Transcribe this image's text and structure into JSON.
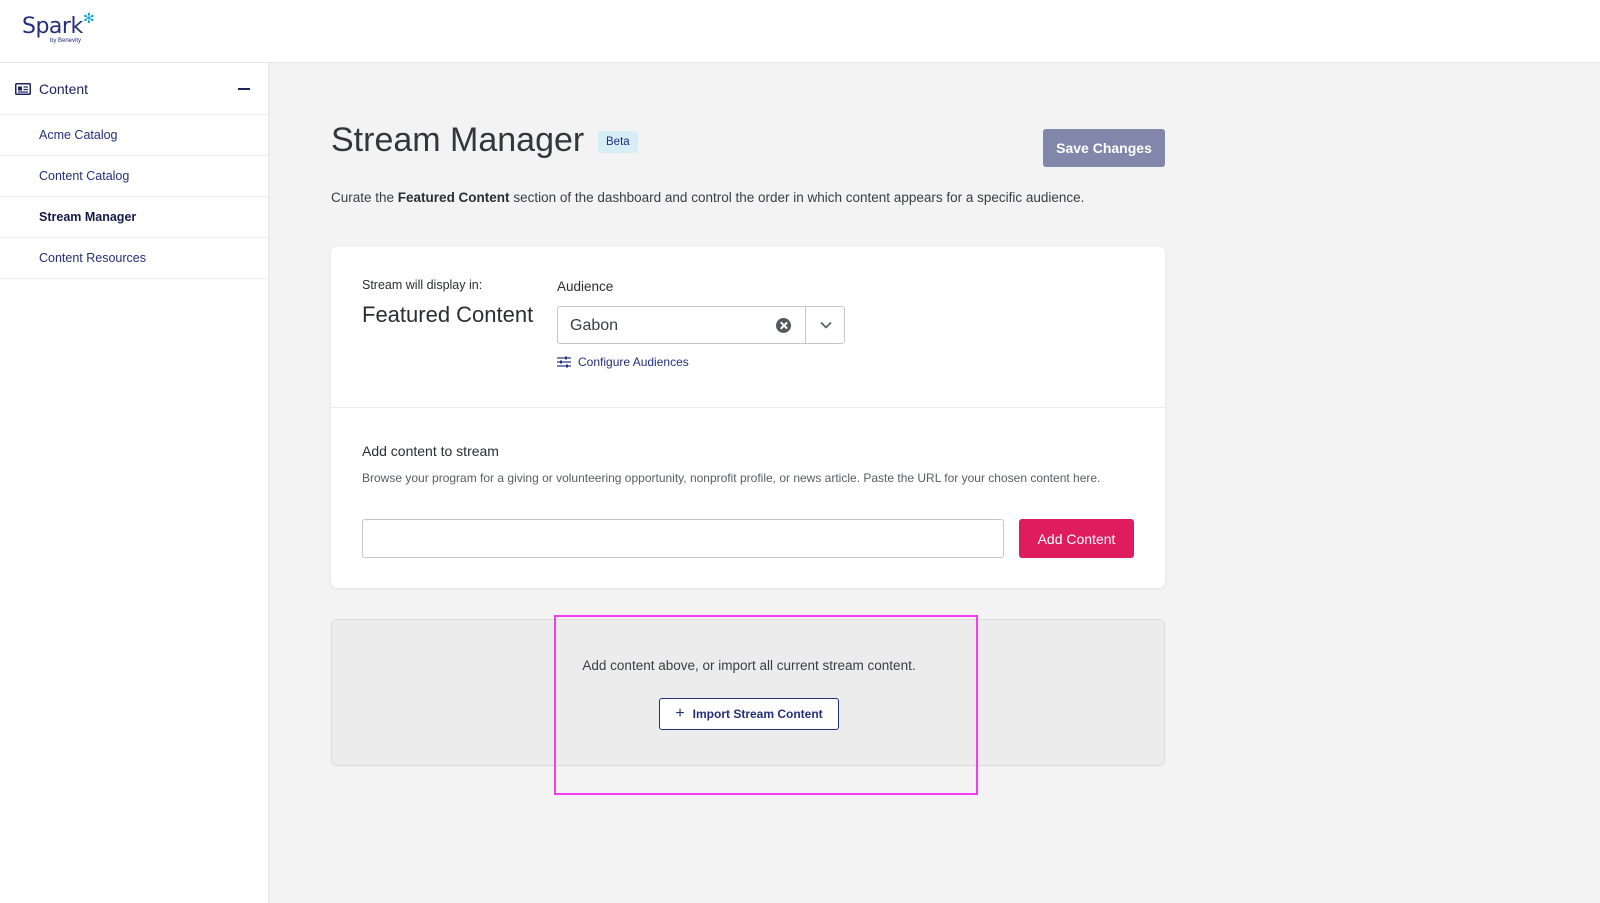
{
  "brand": {
    "name": "Spark",
    "sub": "by Benevity"
  },
  "sidebar": {
    "section_label": "Content",
    "items": [
      {
        "label": "Acme Catalog",
        "active": false
      },
      {
        "label": "Content Catalog",
        "active": false
      },
      {
        "label": "Stream Manager",
        "active": true
      },
      {
        "label": "Content Resources",
        "active": false
      }
    ]
  },
  "header": {
    "title": "Stream Manager",
    "badge": "Beta",
    "save_label": "Save Changes",
    "description_pre": "Curate the ",
    "description_bold": "Featured Content",
    "description_post": " section of the dashboard and control the order in which content appears for a specific audience."
  },
  "stream": {
    "display_label": "Stream will display in:",
    "display_value": "Featured Content",
    "audience_label": "Audience",
    "audience_value": "Gabon",
    "configure_label": "Configure Audiences"
  },
  "add_content": {
    "title": "Add content to stream",
    "help": "Browse your program for a giving or volunteering opportunity, nonprofit profile, or news article. Paste the URL for your chosen content here.",
    "input_value": "",
    "button_label": "Add Content"
  },
  "empty_state": {
    "text": "Add content above, or import all current stream content.",
    "import_label": "Import Stream Content"
  },
  "colors": {
    "primary_navy": "#23307a",
    "accent_pink": "#df1c5e",
    "save_disabled": "#8087ab",
    "highlight": "#f43cf0"
  }
}
